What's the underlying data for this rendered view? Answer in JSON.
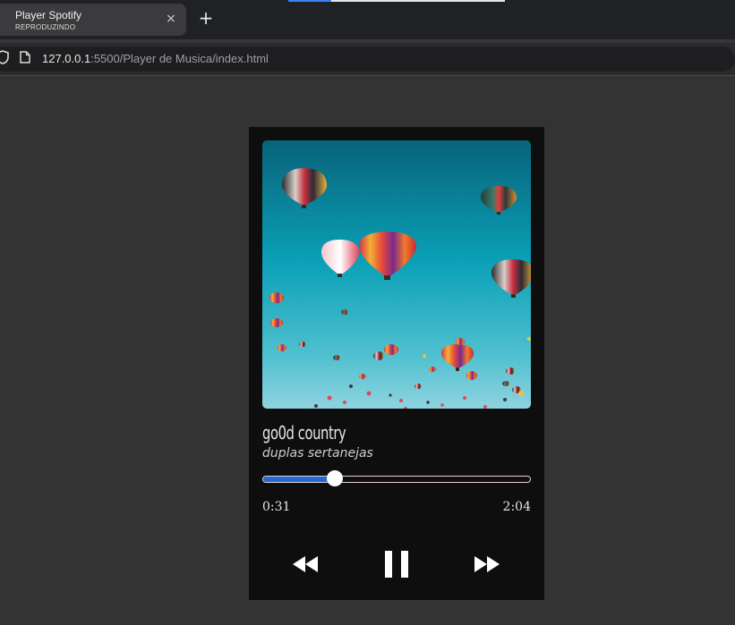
{
  "browser": {
    "tab": {
      "title": "Player Spotify",
      "status": "REPRODUZINDO",
      "close_label": "×"
    },
    "new_tab_label": "+",
    "url": {
      "host": "127.0.0.1",
      "rest": ":5500/Player de Musica/index.html"
    }
  },
  "player": {
    "song_title": "go0d country",
    "artist": "duplas sertanejas",
    "current_time": "0:31",
    "total_time": "2:04",
    "progress": 0.27,
    "controls": {
      "previous_icon": "rewind-icon",
      "play_pause_icon": "pause-icon",
      "next_icon": "fast-forward-icon"
    }
  },
  "colors": {
    "page_bg": "#333333",
    "player_bg": "#0e0e0e",
    "progress_fill": "#1e6bd6",
    "progress_border": "#e9cfcf",
    "sky_top": "#08637a",
    "sky_bottom": "#8fd3df"
  }
}
